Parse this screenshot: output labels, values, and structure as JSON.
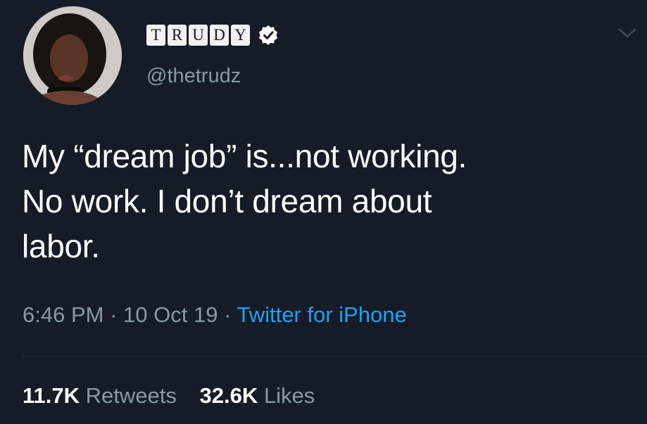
{
  "user": {
    "name_letters": [
      "T",
      "R",
      "U",
      "D",
      "Y"
    ],
    "handle": "@thetrudz",
    "verified_icon": "verified-badge-icon"
  },
  "tweet": {
    "lines": [
      "My “dream job” is...not working.",
      "No work. I don’t dream about",
      "labor."
    ],
    "time": "6:46 PM",
    "separator": "·",
    "date": "10 Oct 19",
    "source": "Twitter for iPhone"
  },
  "stats": {
    "retweets_count": "11.7K",
    "retweets_label": "Retweets",
    "likes_count": "32.6K",
    "likes_label": "Likes"
  },
  "icons": {
    "menu": "chevron-down-icon",
    "avatar": "profile-photo"
  },
  "colors": {
    "background": "#151c28",
    "text": "#ffffff",
    "muted": "#8899a6",
    "accent": "#1da1f2"
  }
}
